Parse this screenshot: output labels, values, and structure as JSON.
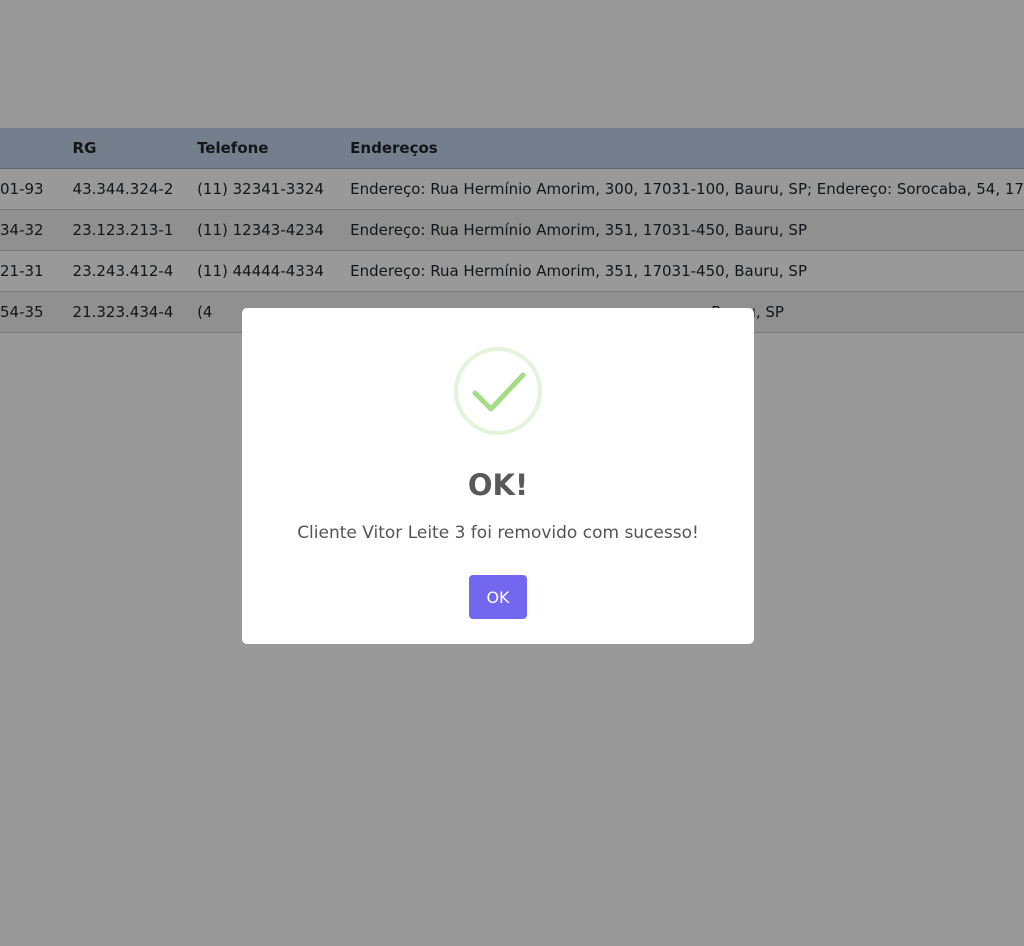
{
  "table": {
    "headers": {
      "cpf": "",
      "rg": "RG",
      "telefone": "Telefone",
      "enderecos": "Endereços"
    },
    "rows": [
      {
        "cpf": "01-93",
        "rg": "43.344.324-2",
        "telefone": "(11) 32341-3324",
        "enderecos": "Endereço: Rua Hermínio Amorim, 300, 17031-100, Bauru, SP; Endereço: Sorocaba, 54, 17"
      },
      {
        "cpf": "34-32",
        "rg": "23.123.213-1",
        "telefone": "(11) 12343-4234",
        "enderecos": "Endereço: Rua Hermínio Amorim, 351, 17031-450, Bauru, SP"
      },
      {
        "cpf": "21-31",
        "rg": "23.243.412-4",
        "telefone": "(11) 44444-4334",
        "enderecos": "Endereço: Rua Hermínio Amorim, 351, 17031-450, Bauru, SP"
      },
      {
        "cpf": "54-35",
        "rg": "21.323.434-4",
        "telefone": "(4",
        "enderecos": "Bauru, SP"
      }
    ]
  },
  "modal": {
    "icon": "success-check-icon",
    "title": "OK!",
    "message": "Cliente Vitor Leite 3 foi removido com sucesso!",
    "confirm_label": "OK"
  },
  "colors": {
    "overlay": "rgba(0,0,0,0.4)",
    "table_header": "#c3d3ec",
    "success_green": "#a5dc86",
    "confirm_button": "#7367f0"
  }
}
